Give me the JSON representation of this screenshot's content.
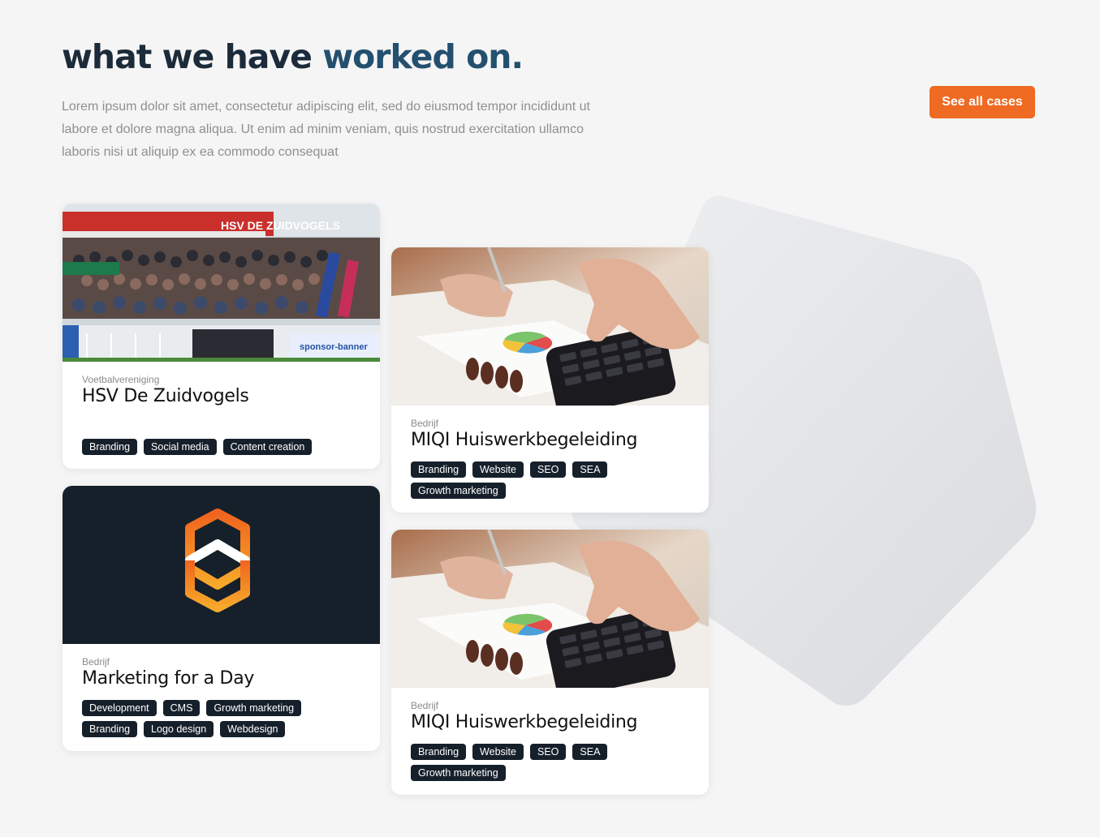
{
  "header": {
    "title_part1": "what we have ",
    "title_part2": "worked on.",
    "intro": "Lorem ipsum dolor sit amet, consectetur adipiscing elit, sed do eiusmod tempor incididunt ut labore et dolore magna aliqua. Ut enim ad minim veniam, quis nostrud exercitation ullamco laboris nisi ut aliquip ex ea commodo consequat",
    "cta_label": "See all cases"
  },
  "colors": {
    "accent": "#ef6a22",
    "dark": "#16202b",
    "heading": "#1c2b3a",
    "heading_accent": "#24506f"
  },
  "cards": [
    {
      "kind": "Voetbalvereniging",
      "title": "HSV De Zuidvogels",
      "image": "football-stadium-photo",
      "stadium_sign": "HSV DE ZUIDVOGELS",
      "banner_text": "sponsor-banner",
      "tags": [
        "Branding",
        "Social media",
        "Content creation"
      ]
    },
    {
      "kind": "Bedrijf",
      "title": "MIQI Huiswerkbegeleiding",
      "image": "calculator-photo",
      "tags": [
        "Branding",
        "Website",
        "SEO",
        "SEA",
        "Growth marketing"
      ]
    },
    {
      "kind": "Bedrijf",
      "title": "Marketing for a Day",
      "image": "hexagon-logo",
      "tags": [
        "Development",
        "CMS",
        "Growth marketing",
        "Branding",
        "Logo design",
        "Webdesign"
      ]
    },
    {
      "kind": "Bedrijf",
      "title": "MIQI Huiswerkbegeleiding",
      "image": "calculator-photo",
      "tags": [
        "Branding",
        "Website",
        "SEO",
        "SEA",
        "Growth marketing"
      ]
    }
  ]
}
